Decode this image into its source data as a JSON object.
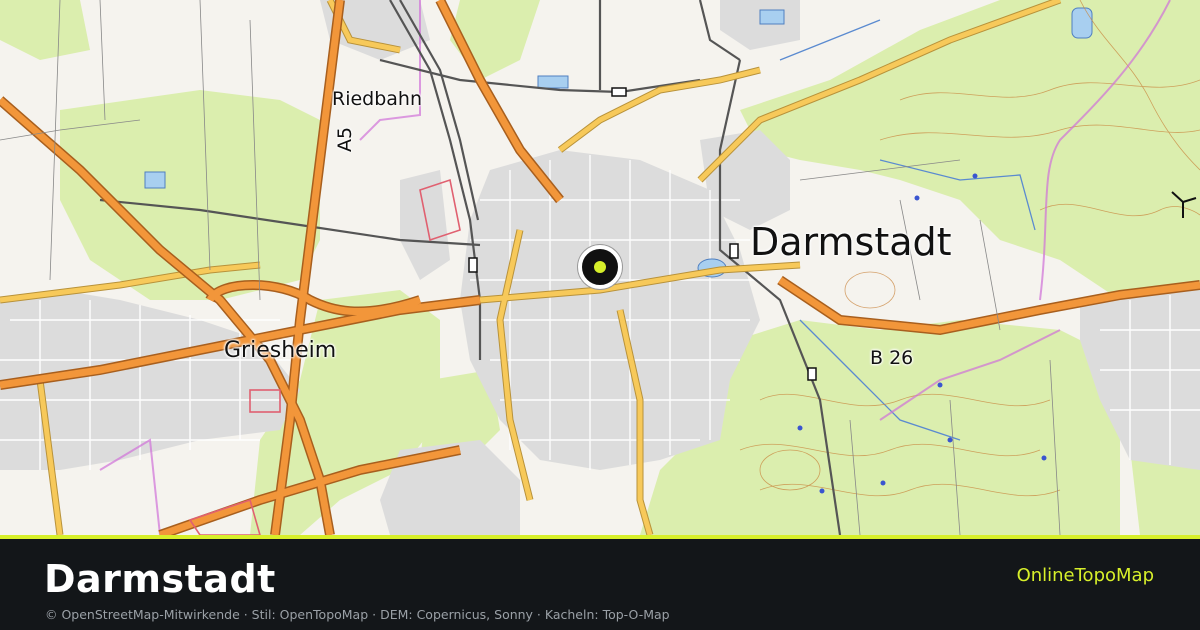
{
  "map": {
    "labels": {
      "city": "Darmstadt",
      "griesheim": "Griesheim",
      "riedbahn": "Riedbahn",
      "highway_a5": "A5",
      "road_b26": "B 26"
    },
    "marker_icon": "location-pin-icon",
    "colors": {
      "forest": "#dbeeae",
      "field": "#f7f5ef",
      "urban": "#d9d9d9",
      "motorway": "#f2963a",
      "main_road": "#f7c95a",
      "street": "#ffffff",
      "water": "#a8cff0",
      "railway": "#555555",
      "contour": "#c9863f",
      "boundary": "#d070d8"
    }
  },
  "footer": {
    "title": "Darmstadt",
    "brand": "OnlineTopoMap",
    "attribution": "© OpenStreetMap-Mitwirkende · Stil: OpenTopoMap · DEM: Copernicus, Sonny · Kacheln: Top-O-Map",
    "accent_color": "#d7ef2a",
    "background_color": "#131619"
  }
}
